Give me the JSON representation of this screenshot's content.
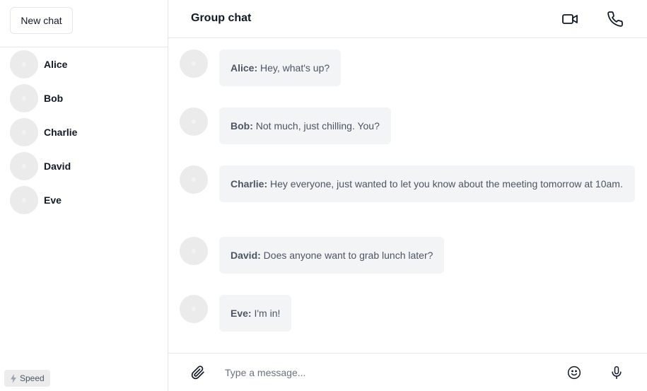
{
  "sidebar": {
    "new_chat_label": "New chat",
    "contacts": [
      {
        "name": "Alice"
      },
      {
        "name": "Bob"
      },
      {
        "name": "Charlie"
      },
      {
        "name": "David"
      },
      {
        "name": "Eve"
      }
    ],
    "speed_badge": "Speed"
  },
  "header": {
    "title": "Group chat",
    "icons": [
      "video-camera-icon",
      "phone-icon"
    ]
  },
  "messages": [
    {
      "sender": "Alice:",
      "text": " Hey, what's up?"
    },
    {
      "sender": "Bob:",
      "text": " Not much, just chilling. You?"
    },
    {
      "sender": "Charlie:",
      "text": " Hey everyone, just wanted to let you know about the meeting tomorrow at 10am."
    },
    {
      "sender": "David:",
      "text": " Does anyone want to grab lunch later?"
    },
    {
      "sender": "Eve:",
      "text": " I'm in!"
    }
  ],
  "composer": {
    "placeholder": "Type a message...",
    "icons": [
      "paperclip-icon",
      "emoji-icon",
      "microphone-icon"
    ]
  },
  "colors": {
    "border": "#e5e7eb",
    "bubble": "#f3f4f6",
    "avatar": "#ebebeb",
    "text_muted": "#4b5563"
  }
}
